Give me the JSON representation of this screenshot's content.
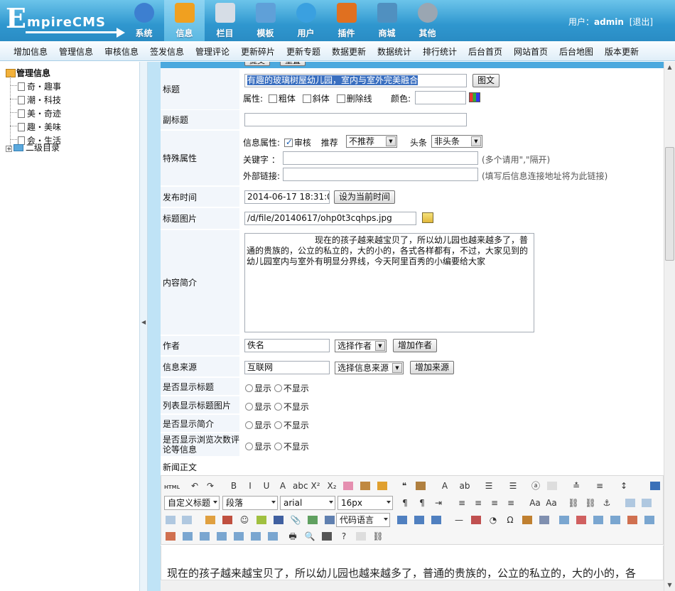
{
  "app": {
    "logo_text": "EmpireCMS"
  },
  "main_nav": [
    {
      "label": "系统",
      "icon": "globe-icon",
      "color": "#3d7fd0"
    },
    {
      "label": "信息",
      "icon": "notepad-pencil-icon",
      "color": "#f0a020"
    },
    {
      "label": "栏目",
      "icon": "folder-icon",
      "color": "#d6dde6"
    },
    {
      "label": "模板",
      "icon": "window-template-icon",
      "color": "#5fa0d8"
    },
    {
      "label": "用户",
      "icon": "user-icon",
      "color": "#3aa0e0"
    },
    {
      "label": "插件",
      "icon": "tools-icon",
      "color": "#e07020"
    },
    {
      "label": "商城",
      "icon": "card-icon",
      "color": "#5090c0"
    },
    {
      "label": "其他",
      "icon": "gear-icon",
      "color": "#9aa6b2"
    }
  ],
  "user": {
    "prefix": "用户：",
    "name": "admin",
    "logout": "[退出]"
  },
  "sub_nav": [
    "增加信息",
    "管理信息",
    "审核信息",
    "签发信息",
    "管理评论",
    "更新碎片",
    "更新专题",
    "数据更新",
    "数据统计",
    "排行统计",
    "后台首页",
    "网站首页",
    "后台地图",
    "版本更新"
  ],
  "tree": {
    "root": "管理信息",
    "items": [
      "奇・趣事",
      "潮・科技",
      "美・奇迹",
      "趣・美味",
      "会・生活"
    ],
    "folder": "二级目录"
  },
  "top_buttons": [
    "提交",
    "重置"
  ],
  "form": {
    "title": {
      "label": "标题",
      "value": "有趣的玻璃树屋幼儿园，室内与室外完美融合",
      "btn": "图文",
      "attr_label": "属性:",
      "bold": "粗体",
      "italic": "斜体",
      "strike": "删除线",
      "color_label": "颜色:"
    },
    "subtitle": {
      "label": "副标题",
      "value": ""
    },
    "special": {
      "label": "特殊属性",
      "attr_label": "信息属性:",
      "audit": "审核",
      "recommend_label": "推荐",
      "recommend_value": "不推荐",
      "headline_label": "头条",
      "headline_value": "非头条",
      "keywords_label": "关键字  ：",
      "keywords_hint": "(多个请用\",\"隔开)",
      "link_label": "外部链接:",
      "link_hint": "(填写后信息连接地址将为此链接)"
    },
    "pubtime": {
      "label": "发布时间",
      "value": "2014-06-17 18:31:04",
      "btn": "设为当前时间"
    },
    "titlepic": {
      "label": "标题图片",
      "value": "/d/file/20140617/ohp0t3cqhps.jpg"
    },
    "intro": {
      "label": "内容简介",
      "value": "　　　　　　　　现在的孩子越来越宝贝了，所以幼儿园也越来越多了，普通的贵族的，公立的私立的，大的小的，各式各样都有，不过，大家见到的幼儿园室内与室外有明显分界线，今天阿里百秀的小编要给大家"
    },
    "author": {
      "label": "作者",
      "value": "佚名",
      "select": "选择作者",
      "btn": "增加作者"
    },
    "source": {
      "label": "信息来源",
      "value": "互联网",
      "select": "选择信息来源",
      "btn": "增加来源"
    },
    "show_title": {
      "label": "是否显示标题"
    },
    "list_pic": {
      "label": "列表显示标题图片"
    },
    "show_intro": {
      "label": "是否显示简介"
    },
    "show_views": {
      "label": "是否显示浏览次数评论等信息"
    },
    "radio_show": "显示",
    "radio_hide": "不显示",
    "news_body": {
      "label": "新闻正文"
    }
  },
  "editor": {
    "source_btn": "HTML",
    "style_select": "自定义标题",
    "para_select": "段落",
    "font_select": "arial",
    "size_select": "16px",
    "code_select": "代码语言",
    "content": "现在的孩子越来越宝贝了，所以幼儿园也越来越多了，普通的贵族的，公立的私立的，大的小的，各"
  }
}
